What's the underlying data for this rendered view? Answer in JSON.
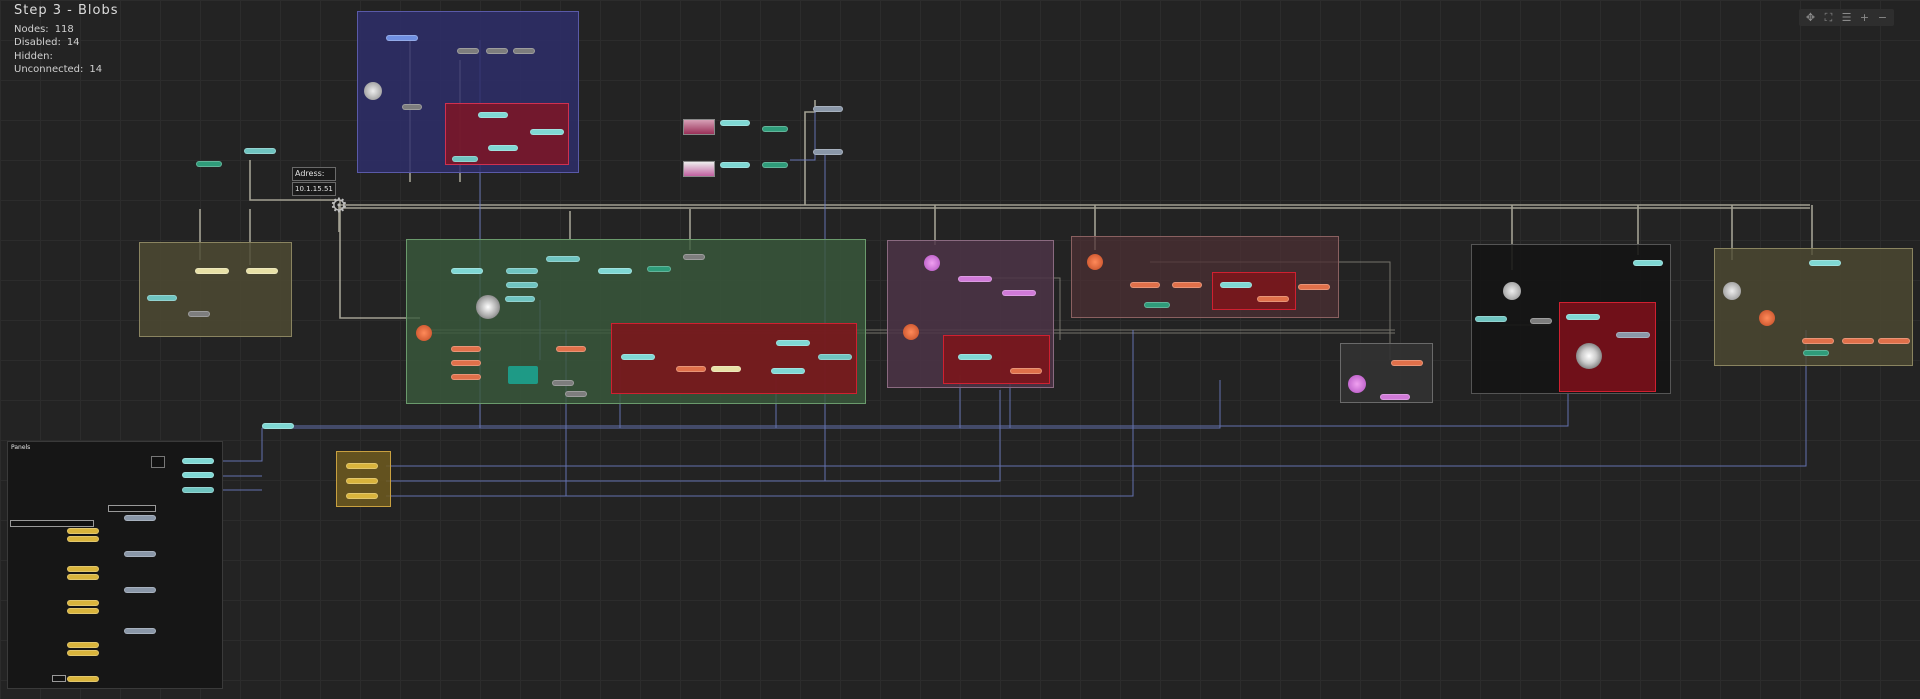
{
  "header": {
    "title": "Step  3  -  Blobs",
    "stats": [
      {
        "label": "Nodes:",
        "value": "118"
      },
      {
        "label": "Disabled:",
        "value": "14"
      },
      {
        "label": "Hidden:",
        "value": ""
      },
      {
        "label": "Unconnected:",
        "value": "14"
      }
    ]
  },
  "toolbar": {
    "buttons": [
      {
        "name": "pan-icon",
        "glyph": "✥"
      },
      {
        "name": "fit-view-icon",
        "glyph": "⛶"
      },
      {
        "name": "align-icon",
        "glyph": "☰"
      },
      {
        "name": "zoom-in-icon",
        "glyph": "+"
      },
      {
        "name": "zoom-out-icon",
        "glyph": "−"
      }
    ]
  },
  "adress": {
    "label": "Adress:",
    "value": "10.1.15.51"
  },
  "panel": {
    "title": "Panels"
  },
  "colors": {
    "background": "#232323",
    "grid": "#2c2c2c",
    "wire_light": "#b9b6a6",
    "wire_blue": "#6f7fc8",
    "group_blue": "#2e2e6a",
    "group_red": "#7a1628",
    "group_green": "#3a5a3c",
    "group_yellow": "#4e4a32",
    "group_purple": "#4c3446"
  }
}
